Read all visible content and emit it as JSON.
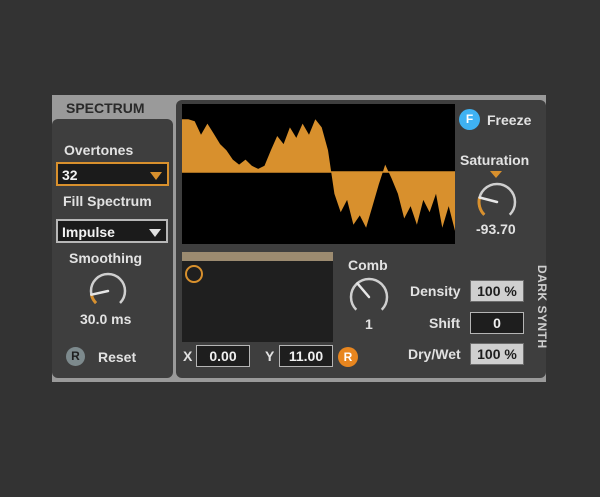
{
  "device": {
    "title": "SPECTRUM",
    "side_label": "DARK SYNTH"
  },
  "colors": {
    "accent": "#d8902d",
    "panel": "#3e3e3e",
    "device_frame": "#9a9a9a",
    "display_bg": "#000000",
    "freeze_blue": "#3fb2f2",
    "r_orange": "#e8861f"
  },
  "overtones": {
    "label": "Overtones",
    "value": "32"
  },
  "fill_spectrum": {
    "label": "Fill Spectrum",
    "value": "Impulse"
  },
  "smoothing": {
    "label": "Smoothing",
    "value": "30.0 ms",
    "level": 0.12
  },
  "reset": {
    "icon": "R",
    "label": "Reset"
  },
  "freeze": {
    "icon": "F",
    "label": "Freeze"
  },
  "saturation": {
    "label": "Saturation",
    "value": "-93.70",
    "level": 0.22
  },
  "comb": {
    "label": "Comb",
    "value": "1",
    "level": 0.35
  },
  "xy": {
    "x_label": "X",
    "x_value": "0.00",
    "y_label": "Y",
    "y_value": "11.00",
    "r_icon": "R"
  },
  "density": {
    "label": "Density",
    "value": "100 %"
  },
  "shift": {
    "label": "Shift",
    "value": "0"
  },
  "dry_wet": {
    "label": "Dry/Wet",
    "value": "100 %"
  },
  "waveform": {
    "color": "#d8902d",
    "peaks": [
      0.85,
      0.85,
      0.82,
      0.6,
      0.78,
      0.62,
      0.45,
      0.35,
      0.2,
      0.12,
      0.2,
      0.1,
      0.05,
      0.1,
      0.35,
      0.58,
      0.45,
      0.72,
      0.55,
      0.78,
      0.6,
      0.85,
      0.72,
      0.35,
      -0.35,
      -0.65,
      -0.45,
      -0.85,
      -0.7,
      -0.9,
      -0.55,
      -0.2,
      0.12,
      -0.1,
      -0.35,
      -0.75,
      -0.55,
      -0.85,
      -0.45,
      -0.65,
      -0.35,
      -0.9,
      -0.55,
      -0.95
    ]
  }
}
